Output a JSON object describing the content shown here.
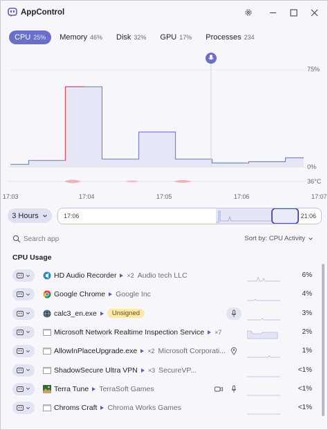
{
  "app": {
    "title": "AppControl"
  },
  "titlebar": {
    "settings_icon": "gear-icon",
    "minimize_icon": "minimize-icon",
    "maximize_icon": "maximize-icon",
    "close_icon": "close-icon"
  },
  "tabs": [
    {
      "label": "CPU",
      "value": "25%",
      "active": true
    },
    {
      "label": "Memory",
      "value": "46%",
      "active": false
    },
    {
      "label": "Disk",
      "value": "32%",
      "active": false
    },
    {
      "label": "GPU",
      "value": "17%",
      "active": false
    },
    {
      "label": "Processes",
      "value": "234",
      "active": false
    }
  ],
  "chart": {
    "y_top_label": "75%",
    "y_bottom_label": "0%",
    "temp_label": "36°C",
    "x_ticks": [
      "17:03",
      "17:04",
      "17:05",
      "17:06",
      "17:07"
    ],
    "marker_icon": "microphone-icon",
    "colors": {
      "line": "#7d82c8",
      "fill": "#e6e7f6",
      "spike": "#e05a6a",
      "temp": "#f0a0a6"
    }
  },
  "chart_data": {
    "type": "area",
    "ylabel": "",
    "ylim": [
      0,
      75
    ],
    "x": [
      "17:03",
      "17:03:30",
      "17:04",
      "17:04:30",
      "17:05",
      "17:05:30",
      "17:06",
      "17:06:30",
      "17:07"
    ],
    "series": [
      {
        "name": "",
        "values": [
          2,
          5,
          62,
          6,
          27,
          6,
          3,
          4,
          7
        ]
      }
    ]
  },
  "range": {
    "label": "3 Hours",
    "start": "17:06",
    "end": "21:06"
  },
  "search": {
    "placeholder": "Search app",
    "icon": "search-icon"
  },
  "sort": {
    "label": "Sort by: CPU Activity"
  },
  "section": {
    "title": "CPU Usage"
  },
  "rows": [
    {
      "name": "HD Audio Recorder",
      "count": "×2",
      "publisher": "Audio tech LLC",
      "percent": "6%",
      "icon": "audio-app-icon",
      "badge": "",
      "indicator": ""
    },
    {
      "name": "Google Chrome",
      "count": "",
      "publisher": "Google Inc",
      "percent": "4%",
      "icon": "chrome-icon",
      "badge": "",
      "indicator": ""
    },
    {
      "name": "calc3_en.exe",
      "count": "",
      "publisher": "",
      "percent": "3%",
      "icon": "globe-app-icon",
      "badge": "Unsigned",
      "indicator": "microphone-icon"
    },
    {
      "name": "Microsoft Network Realtime Inspection Service",
      "count": "×7",
      "publisher": "",
      "percent": "2%",
      "icon": "window-app-icon",
      "badge": "",
      "indicator": ""
    },
    {
      "name": "AllowInPlaceUpgrade.exe",
      "count": "×2",
      "publisher": "Microsoft Corporati...",
      "percent": "1%",
      "icon": "window-app-icon",
      "badge": "",
      "indicator": "location-icon"
    },
    {
      "name": "ShadowSecure Ultra VPN",
      "count": "×3",
      "publisher": "SecureVP...",
      "percent": "<1%",
      "icon": "window-app-icon",
      "badge": "",
      "indicator": ""
    },
    {
      "name": "Terra Tune",
      "count": "",
      "publisher": "TerraSoft Games",
      "percent": "<1%",
      "icon": "terra-tune-icon",
      "badge": "",
      "indicator": "camera-mic-icons"
    },
    {
      "name": "Chroms Craft",
      "count": "",
      "publisher": "Chroma Works Games",
      "percent": "<1%",
      "icon": "window-app-icon",
      "badge": "",
      "indicator": ""
    }
  ]
}
